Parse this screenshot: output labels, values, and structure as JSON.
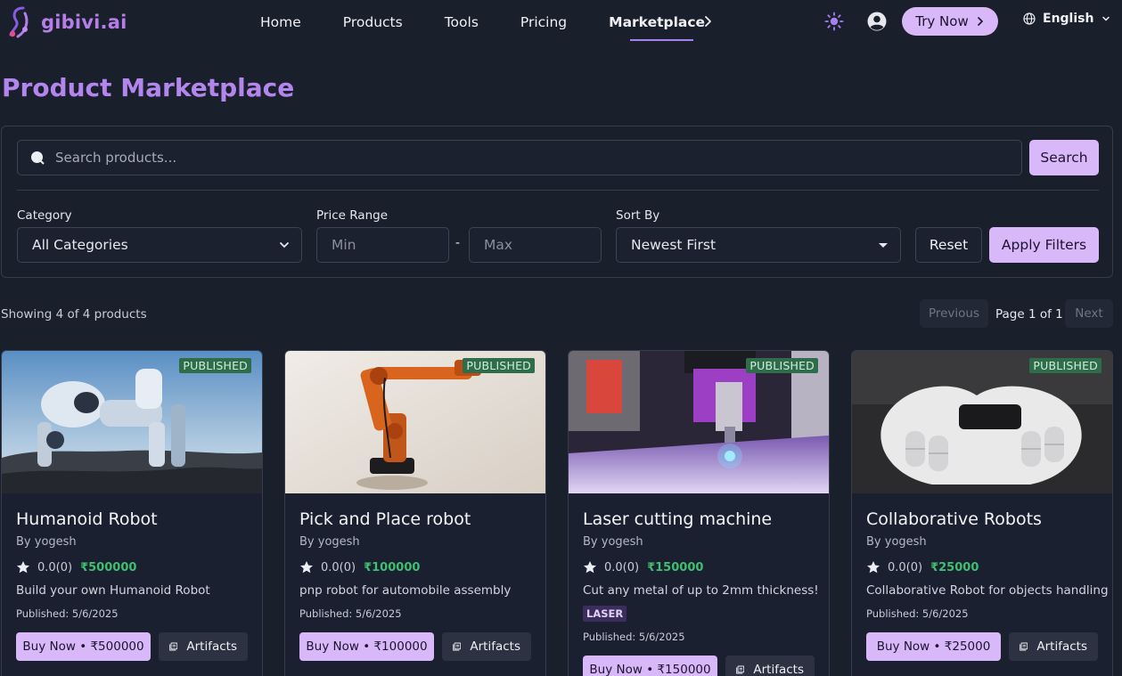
{
  "brand": {
    "name": "gibivi.ai"
  },
  "nav": {
    "links": [
      "Home",
      "Products",
      "Tools",
      "Pricing"
    ],
    "active": "Marketplace",
    "try_now": "Try Now",
    "language": "English"
  },
  "page_title": "Product Marketplace",
  "filters": {
    "search_placeholder": "Search products...",
    "search_button": "Search",
    "category_label": "Category",
    "category_value": "All Categories",
    "price_label": "Price Range",
    "min_placeholder": "Min",
    "max_placeholder": "Max",
    "dash": "-",
    "sort_label": "Sort By",
    "sort_value": "Newest First",
    "reset": "Reset",
    "apply": "Apply Filters"
  },
  "results": {
    "showing": "Showing 4 of 4 products",
    "previous": "Previous",
    "page": "Page 1 of 1",
    "next": "Next"
  },
  "products": [
    {
      "status": "PUBLISHED",
      "title": "Humanoid Robot",
      "by": "By yogesh",
      "rating": "0.0(0)",
      "price": "₹500000",
      "description": "Build your own Humanoid Robot",
      "published": "Published: 5/6/2025",
      "buy": "Buy Now • ₹500000",
      "artifacts": "Artifacts"
    },
    {
      "status": "PUBLISHED",
      "title": "Pick and Place robot",
      "by": "By yogesh",
      "rating": "0.0(0)",
      "price": "₹100000",
      "description": "pnp robot for automobile assembly",
      "published": "Published: 5/6/2025",
      "buy": "Buy Now • ₹100000",
      "artifacts": "Artifacts"
    },
    {
      "status": "PUBLISHED",
      "title": "Laser cutting machine",
      "by": "By yogesh",
      "rating": "0.0(0)",
      "price": "₹150000",
      "description": "Cut any metal of up to 2mm thickness!",
      "tag": "LASER",
      "published": "Published: 5/6/2025",
      "buy": "Buy Now • ₹150000",
      "artifacts": "Artifacts"
    },
    {
      "status": "PUBLISHED",
      "title": "Collaborative Robots",
      "by": "By yogesh",
      "rating": "0.0(0)",
      "price": "₹25000",
      "description": "Collaborative Robot for objects handling",
      "published": "Published: 5/6/2025",
      "buy": "Buy Now • ₹25000",
      "artifacts": "Artifacts"
    }
  ]
}
